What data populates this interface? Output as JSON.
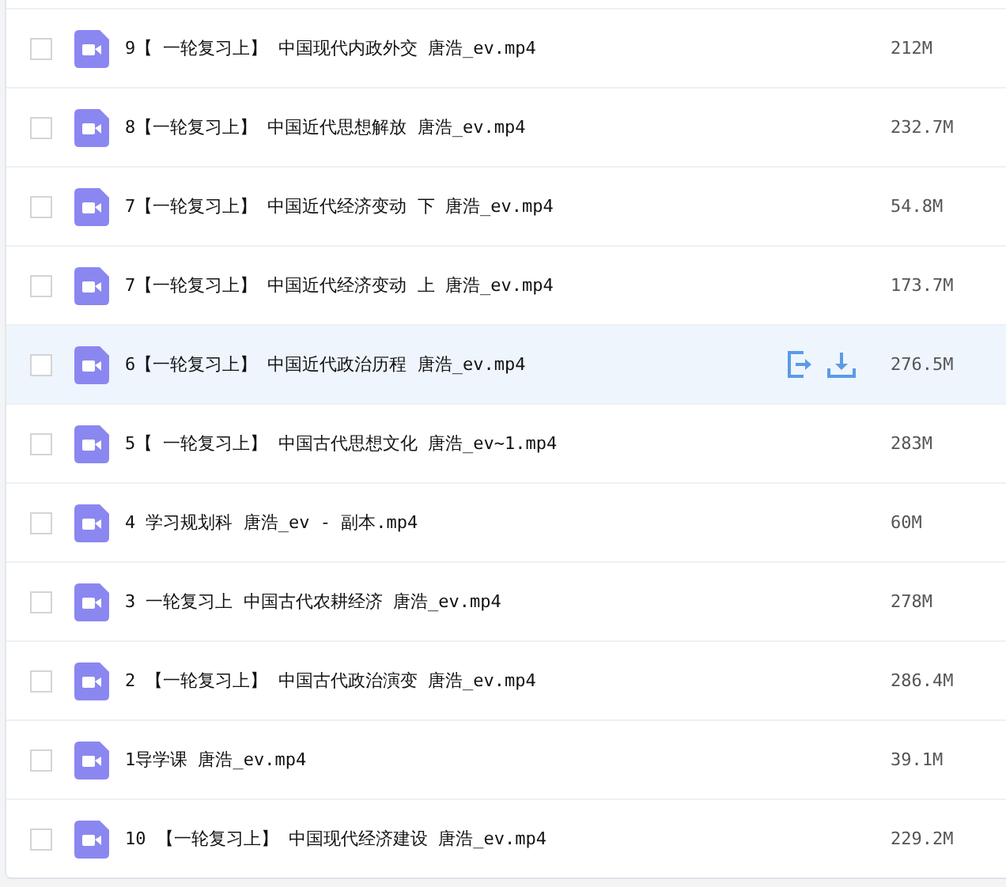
{
  "files": [
    {
      "name": "9【 一轮复习上】 中国现代内政外交 唐浩_ev.mp4",
      "size": "212M",
      "checked": false,
      "hovered": false
    },
    {
      "name": "8【一轮复习上】 中国近代思想解放 唐浩_ev.mp4",
      "size": "232.7M",
      "checked": false,
      "hovered": false
    },
    {
      "name": "7【一轮复习上】 中国近代经济变动 下 唐浩_ev.mp4",
      "size": "54.8M",
      "checked": false,
      "hovered": false
    },
    {
      "name": "7【一轮复习上】 中国近代经济变动 上 唐浩_ev.mp4",
      "size": "173.7M",
      "checked": false,
      "hovered": false
    },
    {
      "name": "6【一轮复习上】 中国近代政治历程 唐浩_ev.mp4",
      "size": "276.5M",
      "checked": false,
      "hovered": true
    },
    {
      "name": "5【 一轮复习上】 中国古代思想文化 唐浩_ev~1.mp4",
      "size": "283M",
      "checked": false,
      "hovered": false
    },
    {
      "name": "4 学习规划科 唐浩_ev - 副本.mp4",
      "size": "60M",
      "checked": false,
      "hovered": false
    },
    {
      "name": "3 一轮复习上 中国古代农耕经济 唐浩_ev.mp4",
      "size": "278M",
      "checked": false,
      "hovered": false
    },
    {
      "name": "2 【一轮复习上】 中国古代政治演变 唐浩_ev.mp4",
      "size": "286.4M",
      "checked": false,
      "hovered": false
    },
    {
      "name": "1导学课 唐浩_ev.mp4",
      "size": "39.1M",
      "checked": false,
      "hovered": false
    },
    {
      "name": "10 【一轮复习上】 中国现代经济建设 唐浩_ev.mp4",
      "size": "229.2M",
      "checked": false,
      "hovered": false
    }
  ]
}
